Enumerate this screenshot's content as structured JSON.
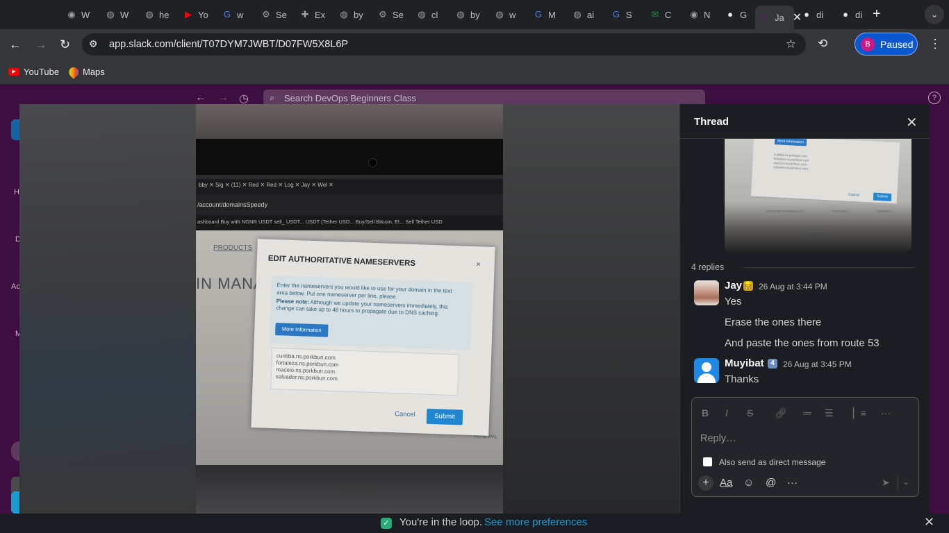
{
  "browser": {
    "tabs": [
      {
        "label": "W",
        "icon": "chrome-icon",
        "color": "#9aa0a6"
      },
      {
        "label": "W",
        "icon": "globe-icon",
        "color": "#9aa0a6"
      },
      {
        "label": "he",
        "icon": "globe-icon",
        "color": "#9aa0a6"
      },
      {
        "label": "Yo",
        "icon": "youtube-icon",
        "color": "#ff0000"
      },
      {
        "label": "w",
        "icon": "google-icon",
        "color": "#4285f4"
      },
      {
        "label": "Se",
        "icon": "gear-icon",
        "color": "#9aa0a6"
      },
      {
        "label": "Ex",
        "icon": "puzzle-icon",
        "color": "#9aa0a6"
      },
      {
        "label": "by",
        "icon": "globe-icon",
        "color": "#9aa0a6"
      },
      {
        "label": "Se",
        "icon": "gear-icon",
        "color": "#9aa0a6"
      },
      {
        "label": "cl",
        "icon": "globe-icon",
        "color": "#9aa0a6"
      },
      {
        "label": "by",
        "icon": "globe-icon",
        "color": "#9aa0a6"
      },
      {
        "label": "w",
        "icon": "globe-icon",
        "color": "#9aa0a6"
      },
      {
        "label": "M",
        "icon": "google-icon",
        "color": "#4285f4"
      },
      {
        "label": "ai",
        "icon": "globe-icon",
        "color": "#9aa0a6"
      },
      {
        "label": "S",
        "icon": "google-icon",
        "color": "#4285f4"
      },
      {
        "label": "C",
        "icon": "mail-icon",
        "color": "#1e8e3e"
      },
      {
        "label": "N",
        "icon": "chrome-icon",
        "color": "#9aa0a6"
      },
      {
        "label": "G",
        "icon": "github-icon",
        "color": "#e8eaed"
      },
      {
        "label": "Ja",
        "icon": "slack-icon",
        "color": "#611f69",
        "active": true
      },
      {
        "label": "di",
        "icon": "github-icon",
        "color": "#e8eaed"
      },
      {
        "label": "di",
        "icon": "github-icon",
        "color": "#e8eaed"
      }
    ],
    "url": "app.slack.com/client/T07DYM7JWBT/D07FW5X8L6P",
    "profile_initial": "B",
    "profile_label": "Paused",
    "bookmarks": [
      {
        "label": "YouTube",
        "icon": "youtube-icon"
      },
      {
        "label": "Maps",
        "icon": "maps-icon"
      }
    ]
  },
  "slack": {
    "search_placeholder": "Search DevOps Beginners Class",
    "sidebar_labels": [
      "H",
      "D",
      "Ac",
      "M"
    ]
  },
  "image_viewer": {
    "photo": {
      "tabs_text": "bby  ✕   Sig  ✕   (11)  ✕   Red  ✕   Red  ✕   Log  ✕   Jay  ✕   Wel  ✕",
      "url_text": "/account/domainsSpeedy",
      "bookmarks_text": "ashboard   Buy with NGNR   USDT sell_ USDT...   USDT (Tether USD...   Buy/Sell Bitcoin, Et...   Sell Tether USD",
      "products": "PRODUCTS",
      "heading": "IN MANA",
      "dialog": {
        "title": "EDIT AUTHORITATIVE NAMESERVERS",
        "close": "×",
        "info": "Enter the nameservers you would like to use for your domain in the text area below. Put one nameserver per line, please.",
        "note_label": "Please note:",
        "note": "Although we update your nameservers immediately, this change can take up to 48 hours to propagate due to DNS caching.",
        "more_button": "More Information",
        "nameservers": [
          "curitiba.ns.porkbun.com",
          "fortaleza.ns.porkbun.com",
          "maceio.ns.porkbun.com",
          "salvador.ns.porkbun.com"
        ],
        "cancel": "Cancel",
        "submit": "Submit"
      },
      "footer_registry": "REGISTRY EXPIRE DATE",
      "footer_statuses": "STATUSES",
      "footer_renewal": "RENEWAL",
      "laptop_label": "MacBook Air"
    }
  },
  "thread": {
    "title": "Thread",
    "replies": "4 replies",
    "messages": [
      {
        "author": "Jay",
        "emoji": "construction-worker",
        "time": "26 Aug at 3:44 PM",
        "lines": [
          "Yes",
          "Erase the ones there",
          "And paste the ones from route 53"
        ]
      },
      {
        "author": "Muyibat",
        "emoji": "keycap-4",
        "time": "26 Aug at 3:45 PM",
        "lines": [
          "Thanks"
        ]
      }
    ],
    "composer": {
      "placeholder": "Reply…",
      "also_send": "Also send as direct message",
      "format_icons": [
        "bold-icon",
        "italic-icon",
        "strikethrough-icon",
        "link-icon",
        "ordered-list-icon",
        "bullet-list-icon",
        "blockquote-icon",
        "more-icon"
      ],
      "bottom_tools": [
        "plus-icon",
        "text-format-icon",
        "emoji-icon",
        "mention-icon",
        "more-icon",
        "send-icon"
      ],
      "format_label": "Aa"
    }
  },
  "banner": {
    "text": "You're in the loop.",
    "link": "See more preferences"
  },
  "colors": {
    "slack_aubergine": "#3f0e40",
    "thread_bg": "#1a1d21",
    "link_blue": "#1d9bd1",
    "profile_blue": "#0b57d0"
  }
}
